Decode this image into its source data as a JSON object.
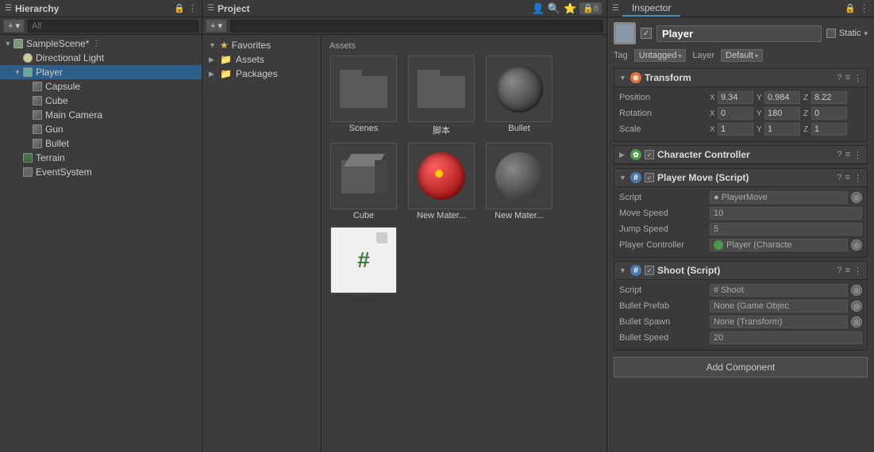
{
  "hierarchy": {
    "title": "Hierarchy",
    "search_placeholder": "All",
    "add_button": "+ ▾",
    "items": [
      {
        "id": "sample-scene",
        "label": "SampleScene*",
        "indent": 0,
        "arrow": "▼",
        "icon": "scene",
        "has_more": true
      },
      {
        "id": "directional-light",
        "label": "Directional Light",
        "indent": 1,
        "arrow": "",
        "icon": "light"
      },
      {
        "id": "player",
        "label": "Player",
        "indent": 1,
        "arrow": "▼",
        "icon": "person",
        "selected": true
      },
      {
        "id": "capsule",
        "label": "Capsule",
        "indent": 2,
        "arrow": "",
        "icon": "cube"
      },
      {
        "id": "cube",
        "label": "Cube",
        "indent": 2,
        "arrow": "",
        "icon": "cube"
      },
      {
        "id": "main-camera",
        "label": "Main Camera",
        "indent": 2,
        "arrow": "",
        "icon": "cube"
      },
      {
        "id": "gun",
        "label": "Gun",
        "indent": 2,
        "arrow": "",
        "icon": "cube"
      },
      {
        "id": "bullet",
        "label": "Bullet",
        "indent": 2,
        "arrow": "",
        "icon": "cube"
      },
      {
        "id": "terrain",
        "label": "Terrain",
        "indent": 1,
        "arrow": "",
        "icon": "terrain"
      },
      {
        "id": "event-system",
        "label": "EventSystem",
        "indent": 1,
        "arrow": "",
        "icon": "event"
      }
    ]
  },
  "project": {
    "title": "Project",
    "search_placeholder": "",
    "folders": [
      {
        "id": "favorites",
        "label": "Favorites",
        "arrow": "▼",
        "star": true
      },
      {
        "id": "assets",
        "label": "Assets",
        "arrow": "▶"
      },
      {
        "id": "packages",
        "label": "Packages",
        "arrow": "▶"
      }
    ],
    "asset_section": "Assets",
    "assets_row1": [
      {
        "id": "scenes",
        "label": "Scenes",
        "type": "folder"
      },
      {
        "id": "jiaoben",
        "label": "脚本",
        "type": "folder"
      },
      {
        "id": "bullet-asset",
        "label": "Bullet",
        "type": "sphere"
      }
    ],
    "assets_row2": [
      {
        "id": "cube-asset",
        "label": "Cube",
        "type": "cube"
      },
      {
        "id": "new-material-1",
        "label": "New Mater...",
        "type": "red-sphere"
      },
      {
        "id": "new-material-2",
        "label": "New Mater...",
        "type": "sphere"
      }
    ],
    "assets_row3": [
      {
        "id": "shoot-script",
        "label": "Shoot",
        "type": "script"
      }
    ]
  },
  "inspector": {
    "title": "Inspector",
    "gameobject_name": "Player",
    "tag_label": "Tag",
    "tag_value": "Untagged",
    "layer_label": "Layer",
    "layer_value": "Default",
    "static_label": "Static",
    "transform": {
      "title": "Transform",
      "position_label": "Position",
      "pos_x": "9.34",
      "pos_y": "0.984",
      "pos_z": "8.22",
      "rotation_label": "Rotation",
      "rot_x": "0",
      "rot_y": "180",
      "rot_z": "0",
      "scale_label": "Scale",
      "scale_x": "1",
      "scale_y": "1",
      "scale_z": "1"
    },
    "character_controller": {
      "title": "Character Controller"
    },
    "player_move": {
      "title": "Player Move (Script)",
      "script_label": "Script",
      "script_value": "● PlayerMove",
      "move_speed_label": "Move Speed",
      "move_speed_value": "10",
      "jump_speed_label": "Jump Speed",
      "jump_speed_value": "5",
      "player_controller_label": "Player Controller",
      "player_controller_value": "Player (Characte"
    },
    "shoot": {
      "title": "Shoot (Script)",
      "script_label": "Script",
      "script_value": "# Shoot",
      "bullet_prefab_label": "Bullet Prefab",
      "bullet_prefab_value": "None (Game Objec",
      "bullet_spawn_label": "Bullet Spawn",
      "bullet_spawn_value": "None (Transform)",
      "bullet_speed_label": "Bullet Speed",
      "bullet_speed_value": "20"
    },
    "add_component_label": "Add Component"
  }
}
